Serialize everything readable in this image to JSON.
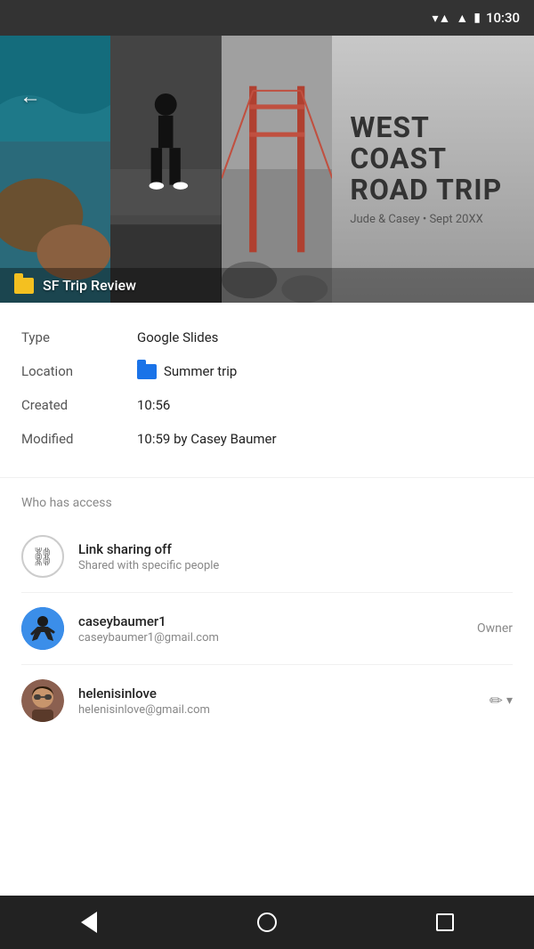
{
  "statusBar": {
    "time": "10:30"
  },
  "preview": {
    "backLabel": "←",
    "fileIconColor": "#f4c020",
    "title": "SF Trip Review",
    "roadtrip": {
      "line1": "WEST COAST",
      "line2": "ROAD TRIP",
      "subtitle": "Jude & Casey • Sept 20XX"
    }
  },
  "info": {
    "typeLabel": "Type",
    "typeValue": "Google Slides",
    "locationLabel": "Location",
    "locationValue": "Summer trip",
    "createdLabel": "Created",
    "createdValue": "10:56",
    "modifiedLabel": "Modified",
    "modifiedValue": "10:59 by Casey Baumer"
  },
  "access": {
    "heading": "Who has access",
    "linkSharing": {
      "title": "Link sharing off",
      "subtitle": "Shared with specific people"
    },
    "users": [
      {
        "username": "caseybaumer1",
        "email": "caseybaumer1@gmail.com",
        "role": "Owner"
      },
      {
        "username": "helenisinlove",
        "email": "helenisinlove@gmail.com",
        "role": "edit"
      }
    ]
  },
  "bottomNav": {
    "backLabel": "back",
    "homeLabel": "home",
    "recentLabel": "recent"
  }
}
